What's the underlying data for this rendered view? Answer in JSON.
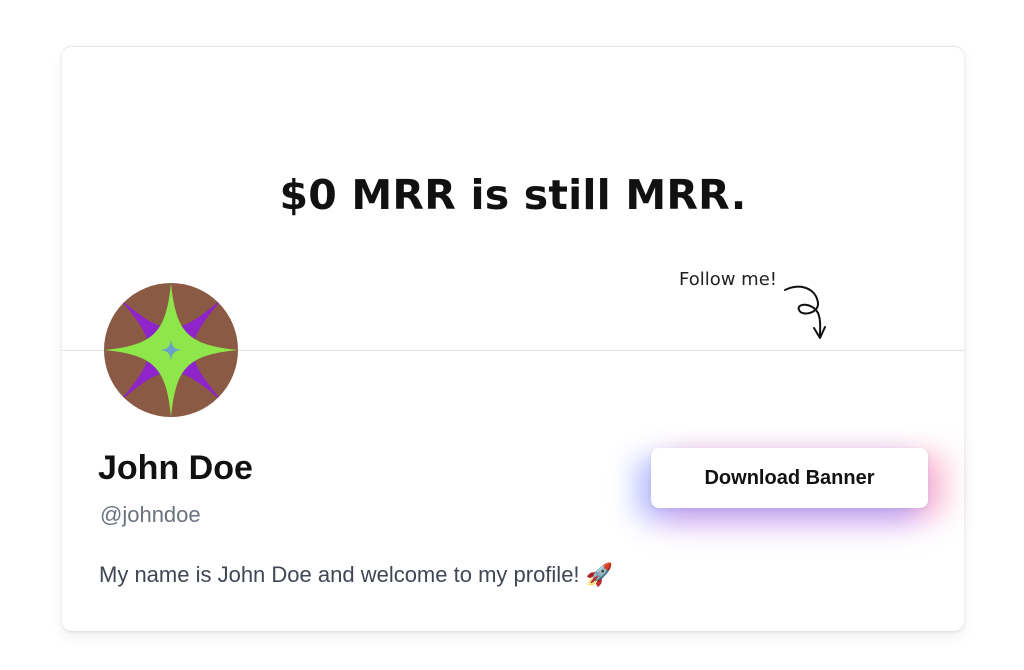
{
  "banner": {
    "headline": "$0 MRR is still MRR.",
    "follow_label": "Follow me!"
  },
  "profile": {
    "name": "John Doe",
    "handle": "@johndoe",
    "bio": "My name is John Doe and welcome to my profile! 🚀",
    "avatar_icon": "four-point-star-avatar-icon"
  },
  "actions": {
    "download_label": "Download Banner"
  },
  "colors": {
    "avatar_background": "#8b5a45",
    "avatar_ring": "#8e24c9",
    "avatar_star": "#8ee64a",
    "avatar_center": "#6aa0c8",
    "button_glow_left": "#7896ff",
    "button_glow_right": "#ff6e8c"
  }
}
